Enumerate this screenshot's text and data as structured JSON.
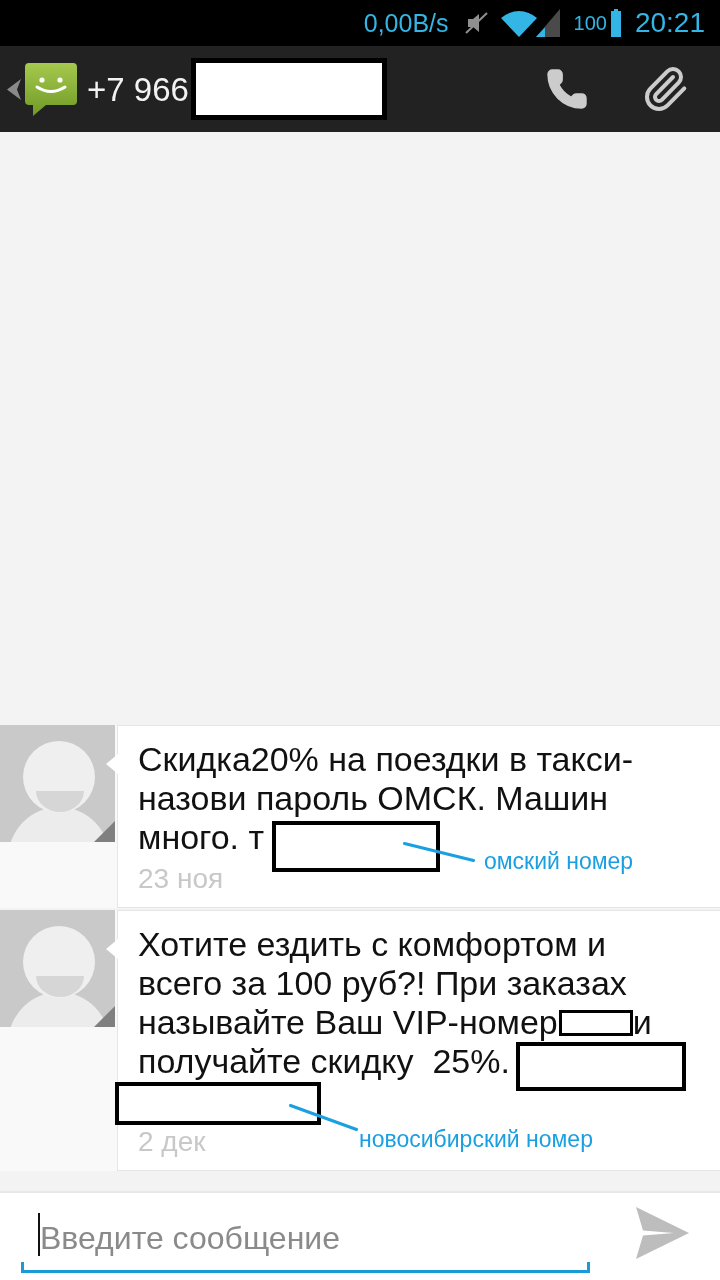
{
  "status_bar": {
    "network_speed": "0,00B/s",
    "battery": "100",
    "time": "20:21"
  },
  "action_bar": {
    "title": "+7 966",
    "title_redacted": true
  },
  "messages": [
    {
      "lines": [
        [
          {
            "kind": "text",
            "text": "Скидка20% на поездки в такси-"
          }
        ],
        [
          {
            "kind": "text",
            "text": "назови пароль ОМСК. Машин"
          }
        ],
        [
          {
            "kind": "text",
            "text": "много. т"
          },
          {
            "kind": "redaction"
          }
        ]
      ],
      "date": "23 ноя",
      "annotation": "омский номер"
    },
    {
      "lines": [
        [
          {
            "kind": "text",
            "text": "Хотите ездить с комфортом и"
          }
        ],
        [
          {
            "kind": "text",
            "text": "всего за 100 руб?! При заказах"
          }
        ],
        [
          {
            "kind": "text",
            "text": "называйте Ваш VIP-номер"
          },
          {
            "kind": "redaction"
          },
          {
            "kind": "text",
            "text": "и"
          }
        ],
        [
          {
            "kind": "text",
            "text": "получайте скидку  25%."
          },
          {
            "kind": "redaction"
          }
        ],
        [
          {
            "kind": "redaction"
          }
        ]
      ],
      "date": "2 дек",
      "annotation": "новосибирский номер"
    }
  ],
  "compose": {
    "placeholder": "Введите сообщение"
  }
}
